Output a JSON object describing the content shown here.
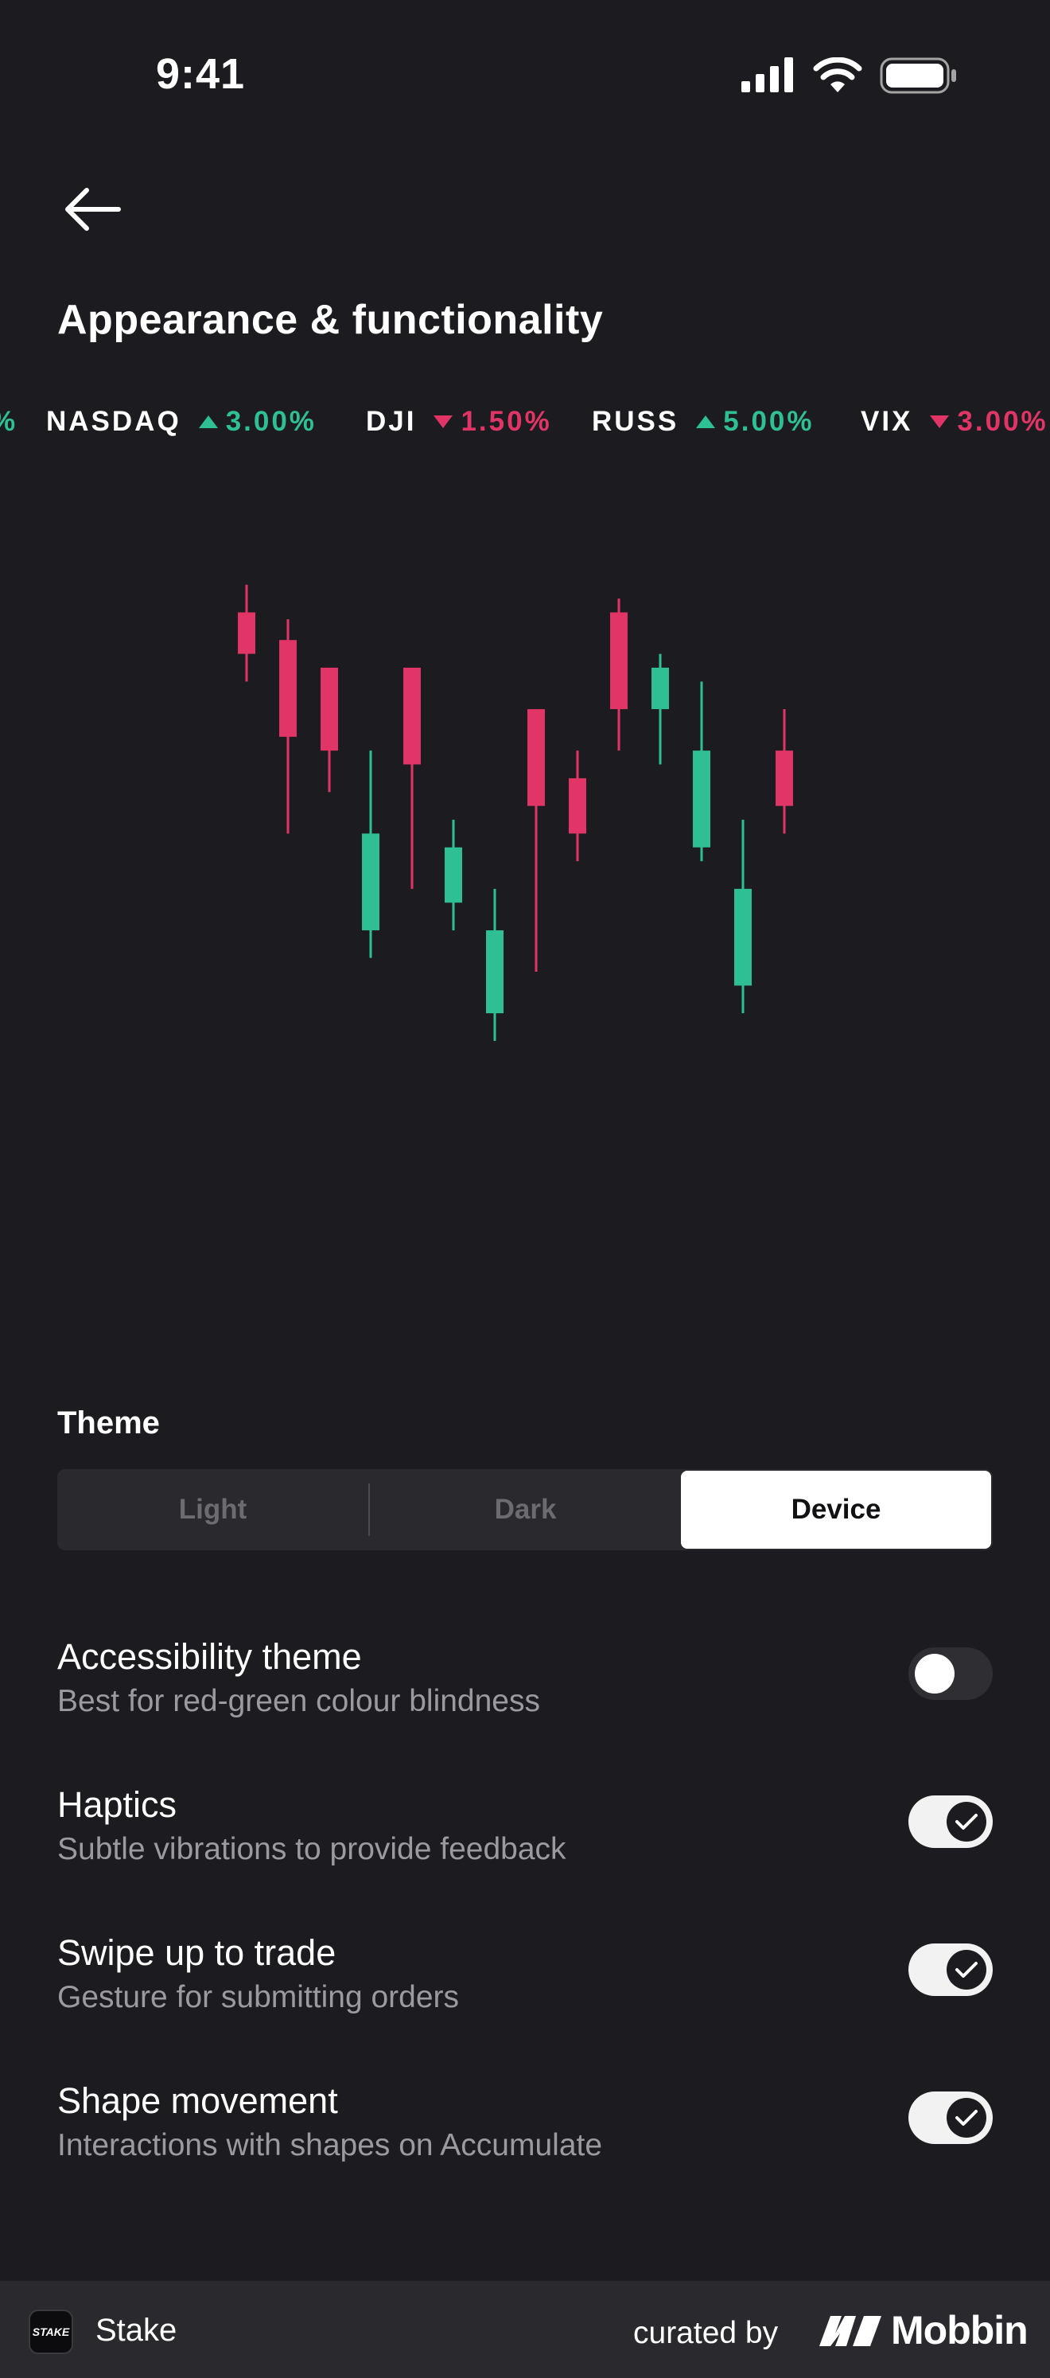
{
  "status_bar": {
    "time": "9:41"
  },
  "header": {
    "title": "Appearance & functionality"
  },
  "ticker": [
    {
      "name": "NASDAQ",
      "direction": "up",
      "change": "3.00%"
    },
    {
      "name": "DJI",
      "direction": "down",
      "change": "1.50%"
    },
    {
      "name": "RUSS",
      "direction": "up",
      "change": "5.00%"
    },
    {
      "name": "VIX",
      "direction": "down",
      "change": "3.00%"
    }
  ],
  "colors": {
    "up": "#2fbf94",
    "down": "#e03566",
    "background": "#1c1c20"
  },
  "chart_data": {
    "type": "candlestick",
    "candles": [
      {
        "open": 5.9,
        "close": 5.6,
        "high": 6.1,
        "low": 5.4
      },
      {
        "open": 5.7,
        "close": 5.0,
        "high": 5.85,
        "low": 4.3
      },
      {
        "open": 5.5,
        "close": 4.9,
        "high": 5.0,
        "low": 4.6
      },
      {
        "open": 3.6,
        "close": 4.3,
        "high": 4.9,
        "low": 3.4
      },
      {
        "open": 5.5,
        "close": 4.8,
        "high": 5.0,
        "low": 3.9
      },
      {
        "open": 3.8,
        "close": 4.2,
        "high": 4.4,
        "low": 3.6
      },
      {
        "open": 3.0,
        "close": 3.6,
        "high": 3.9,
        "low": 2.8
      },
      {
        "open": 5.2,
        "close": 4.5,
        "high": 4.7,
        "low": 3.3
      },
      {
        "open": 4.7,
        "close": 4.3,
        "high": 4.9,
        "low": 4.1
      },
      {
        "open": 5.9,
        "close": 5.2,
        "high": 6.0,
        "low": 4.9
      },
      {
        "open": 5.2,
        "close": 5.5,
        "high": 5.6,
        "low": 4.8
      },
      {
        "open": 4.2,
        "close": 4.9,
        "high": 5.4,
        "low": 4.1
      },
      {
        "open": 3.2,
        "close": 3.9,
        "high": 4.4,
        "low": 3.0
      },
      {
        "open": 4.9,
        "close": 4.5,
        "high": 5.2,
        "low": 4.3
      }
    ]
  },
  "theme": {
    "label": "Theme",
    "options": [
      "Light",
      "Dark",
      "Device"
    ],
    "selected": "Device"
  },
  "settings": [
    {
      "title": "Accessibility theme",
      "subtitle": "Best for red-green colour blindness",
      "enabled": false
    },
    {
      "title": "Haptics",
      "subtitle": "Subtle vibrations to provide feedback",
      "enabled": true
    },
    {
      "title": "Swipe up to trade",
      "subtitle": "Gesture for submitting orders",
      "enabled": true
    },
    {
      "title": "Shape movement",
      "subtitle": "Interactions with shapes on Accumulate",
      "enabled": true
    }
  ],
  "footer": {
    "logo_text": "STAKE",
    "app_name": "Stake",
    "curated_by": "curated by",
    "brand": "Mobbin"
  }
}
